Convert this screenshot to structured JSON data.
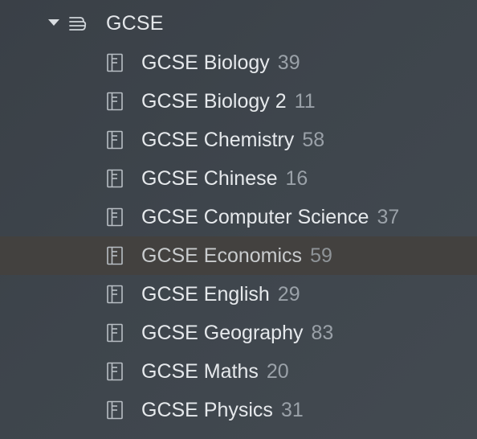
{
  "group": {
    "label": "GCSE",
    "expanded": true,
    "icon": "stack-icon"
  },
  "items": [
    {
      "label": "GCSE Biology",
      "count": "39",
      "selected": false,
      "icon": "document-icon"
    },
    {
      "label": "GCSE Biology 2",
      "count": "11",
      "selected": false,
      "icon": "document-icon"
    },
    {
      "label": "GCSE Chemistry",
      "count": "58",
      "selected": false,
      "icon": "document-icon"
    },
    {
      "label": "GCSE Chinese",
      "count": "16",
      "selected": false,
      "icon": "document-icon"
    },
    {
      "label": "GCSE Computer Science",
      "count": "37",
      "selected": false,
      "icon": "document-icon"
    },
    {
      "label": "GCSE Economics",
      "count": "59",
      "selected": true,
      "icon": "document-icon"
    },
    {
      "label": "GCSE English",
      "count": "29",
      "selected": false,
      "icon": "document-icon"
    },
    {
      "label": "GCSE Geography",
      "count": "83",
      "selected": false,
      "icon": "document-icon"
    },
    {
      "label": "GCSE Maths",
      "count": "20",
      "selected": false,
      "icon": "document-icon"
    },
    {
      "label": "GCSE Physics",
      "count": "31",
      "selected": false,
      "icon": "document-icon"
    }
  ],
  "colors": {
    "background": "#3e454c",
    "selected_row": "#43413f",
    "text": "#e6e9ec",
    "count": "#9aa1a8"
  }
}
